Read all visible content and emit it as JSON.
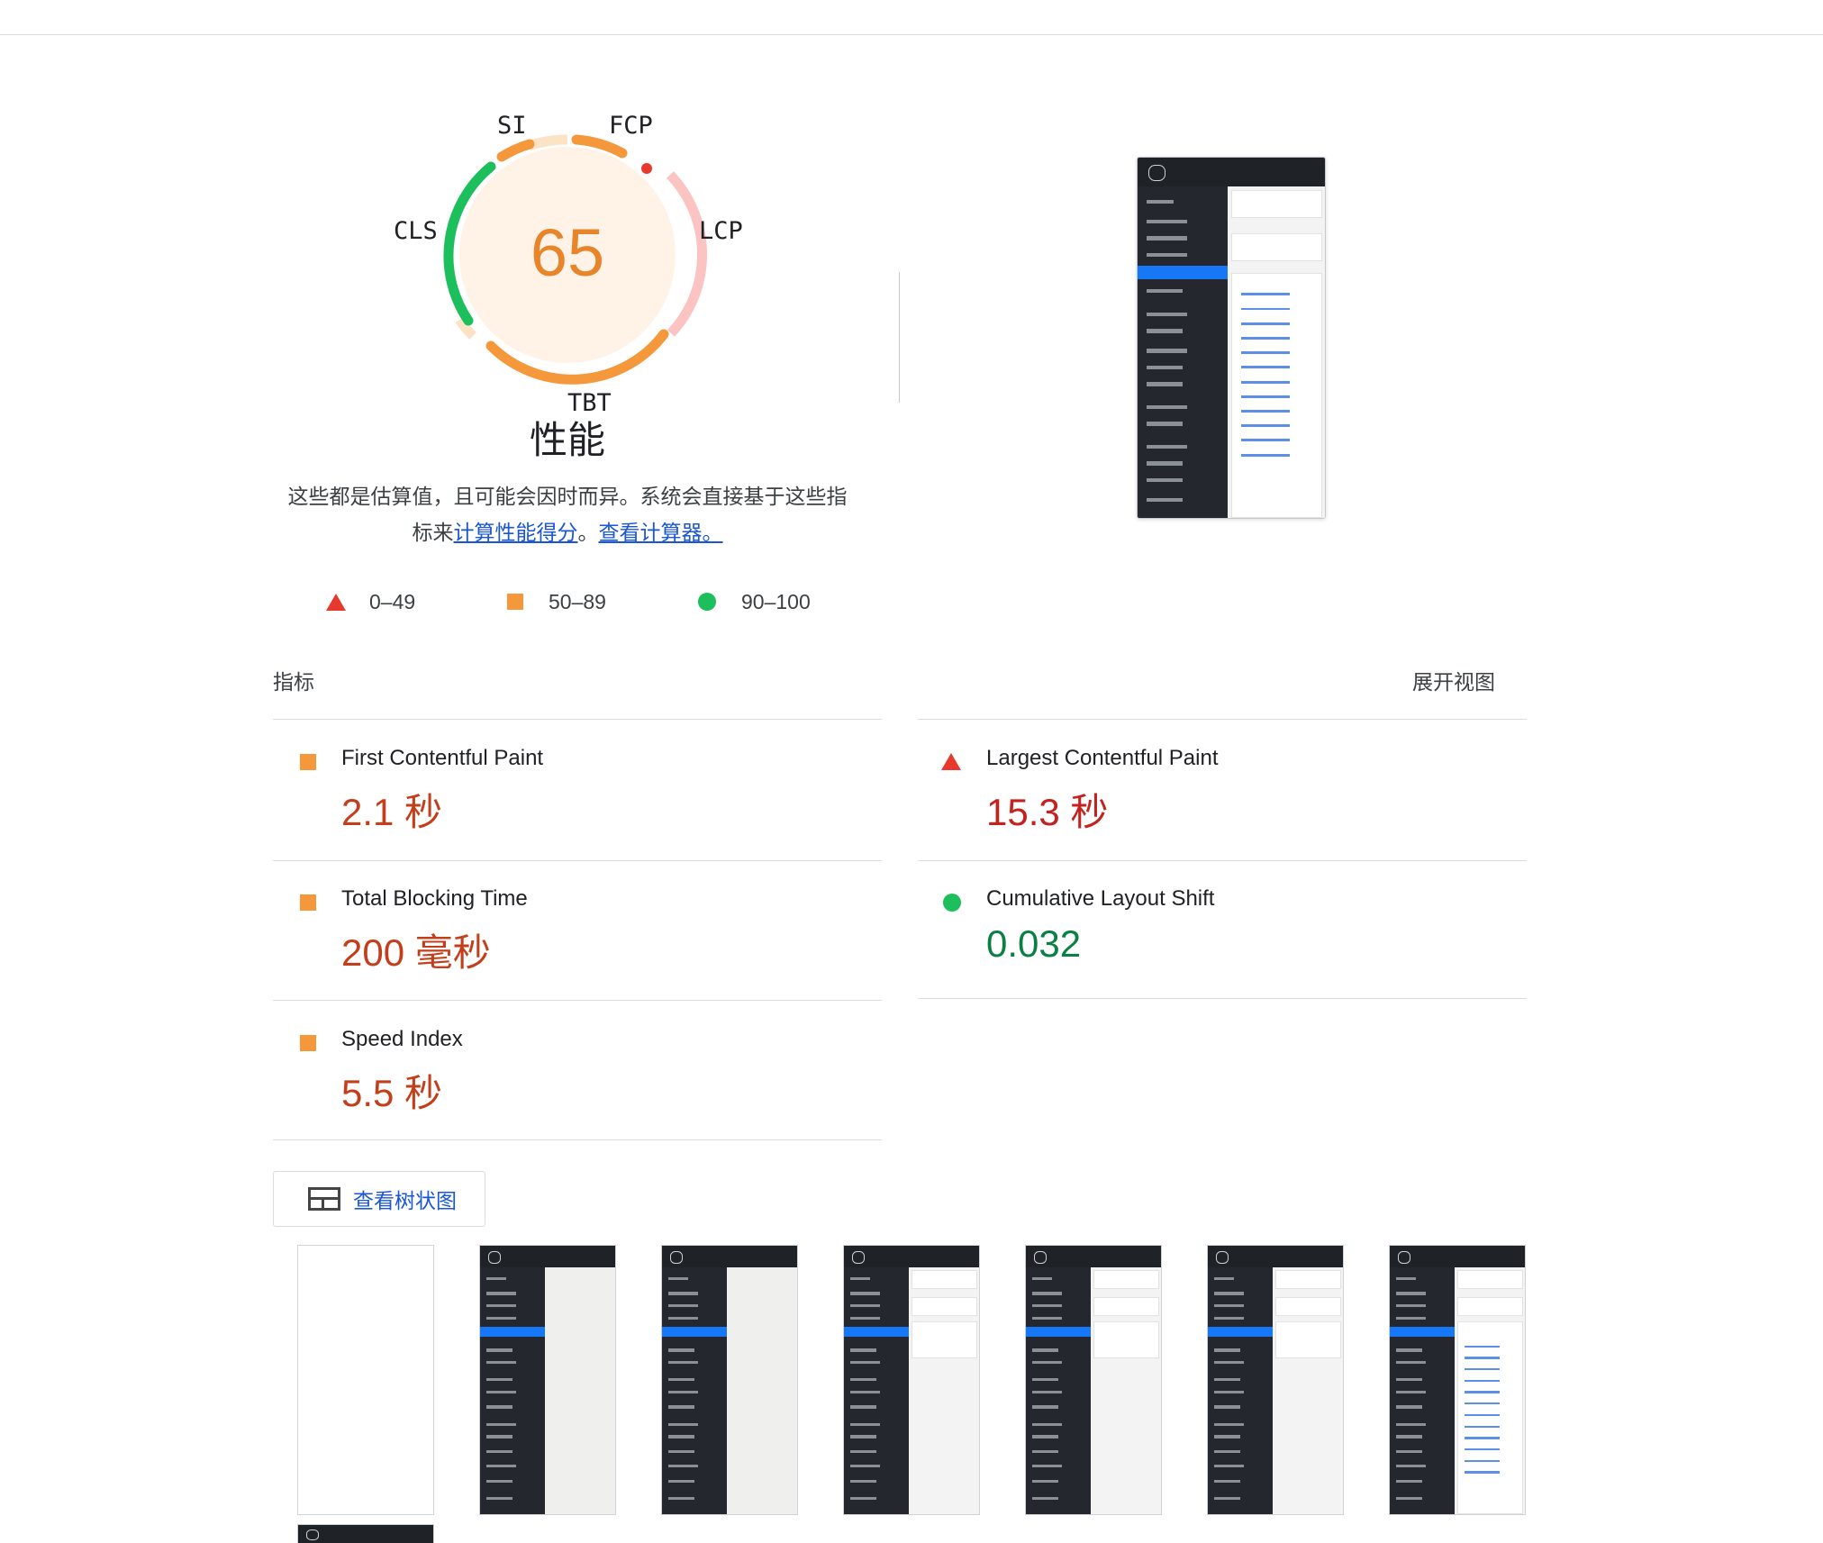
{
  "gauge": {
    "score": "65",
    "title": "性能",
    "labels": {
      "si": "SI",
      "fcp": "FCP",
      "lcp": "LCP",
      "tbt": "TBT",
      "cls": "CLS"
    },
    "colors": {
      "average": "#f4983b",
      "fail": "#e8392e",
      "pass": "#1cbf5c"
    }
  },
  "description": {
    "text1": "这些都是估算值，且可能会因时而异。系统会直接基于这些指",
    "text2": "标来",
    "link1": "计算性能得分",
    "text3": "。",
    "link2": "查看计算器。"
  },
  "legend": [
    {
      "icon": "triangle-fail",
      "range": "0–49"
    },
    {
      "icon": "square-average",
      "range": "50–89"
    },
    {
      "icon": "circle-pass",
      "range": "90–100"
    }
  ],
  "metrics_header": {
    "title": "指标",
    "expand": "展开视图"
  },
  "metrics": [
    {
      "name": "First Contentful Paint",
      "value": "2.1 秒",
      "rating": "average"
    },
    {
      "name": "Largest Contentful Paint",
      "value": "15.3 秒",
      "rating": "fail"
    },
    {
      "name": "Total Blocking Time",
      "value": "200 毫秒",
      "rating": "average"
    },
    {
      "name": "Cumulative Layout Shift",
      "value": "0.032",
      "rating": "pass"
    },
    {
      "name": "Speed Index",
      "value": "5.5 秒",
      "rating": "average"
    }
  ],
  "treemap_button": {
    "label": "查看树状图",
    "icon": "treemap-icon"
  },
  "filmstrip": {
    "frame_count": 7
  }
}
